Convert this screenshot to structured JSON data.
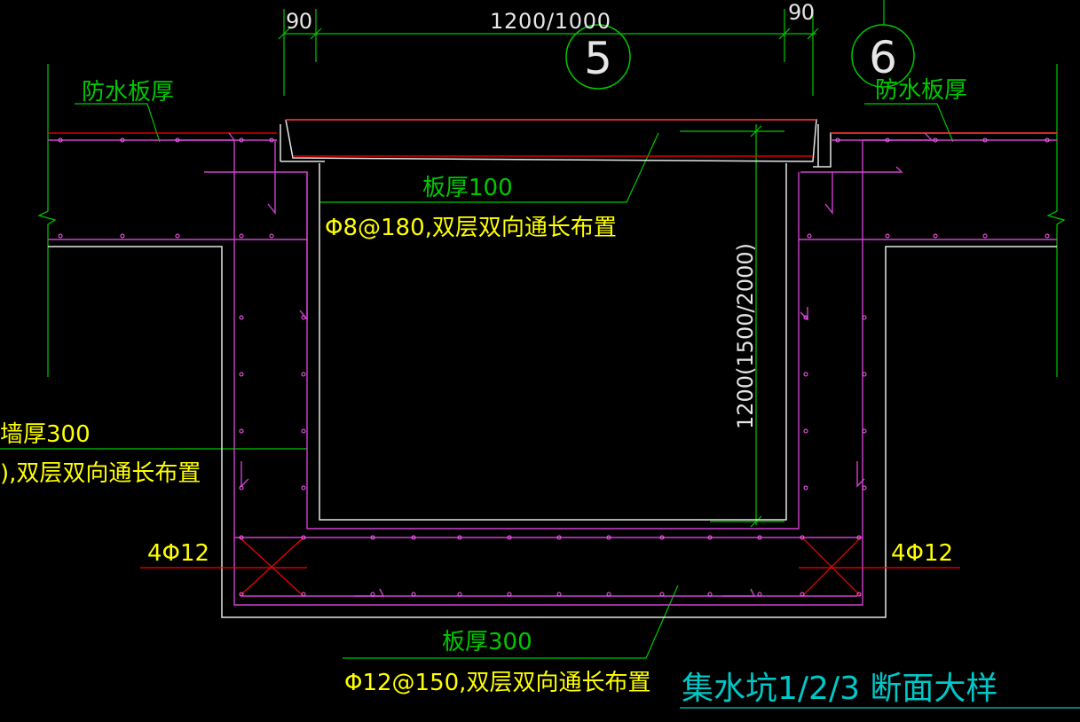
{
  "colors": {
    "background": "#000000",
    "green": "#00c800",
    "yellow": "#ffff00",
    "magenta": "#d040d0",
    "red": "#ff0000",
    "white": "#e6e6e6",
    "cyan": "#00c8c8",
    "rebar_dot": "#ff60ff"
  },
  "dimensions": {
    "top_left": "90",
    "top_center": "1200/1000",
    "top_right": "90",
    "depth": "1200(1500/2000)"
  },
  "axes": {
    "axis_5": "5",
    "axis_6": "6"
  },
  "labels": {
    "waterproof_left": "防水板厚",
    "waterproof_right": "防水板厚",
    "cover_thickness": "板厚100",
    "cover_rebar": "Φ8@180,双层双向通长布置",
    "wall_thickness": "墙厚300",
    "wall_rebar": "),双层双向通长布置",
    "corner_bars_left": "4Φ12",
    "corner_bars_right": "4Φ12",
    "base_thickness": "板厚300",
    "base_rebar": "Φ12@150,双层双向通长布置",
    "title": "集水坑1/2/3  断面大样"
  }
}
